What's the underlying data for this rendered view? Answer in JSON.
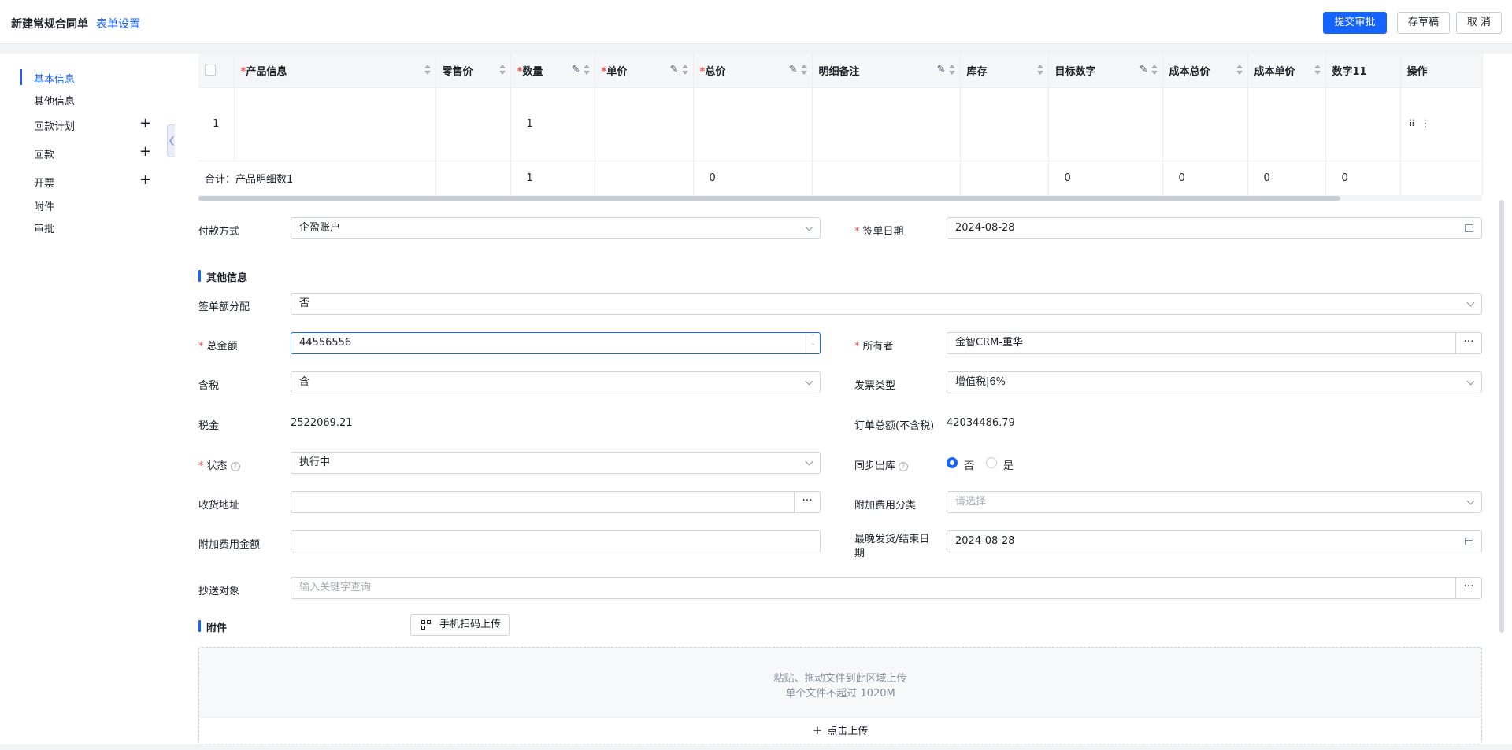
{
  "header": {
    "title": "新建常规合同单",
    "form_settings": "表单设置",
    "submit": "提交审批",
    "draft": "存草稿",
    "cancel": "取 消"
  },
  "sidebar": {
    "items": [
      {
        "label": "基本信息",
        "active": true
      },
      {
        "label": "其他信息"
      },
      {
        "label": "回款计划",
        "has_add": true
      },
      {
        "label": "回款",
        "has_add": true
      },
      {
        "label": "开票",
        "has_add": true
      },
      {
        "label": "附件"
      },
      {
        "label": "审批"
      }
    ],
    "collapse_icon": "collapse-left-icon"
  },
  "table": {
    "columns": [
      {
        "label": "产品信息",
        "required": true
      },
      {
        "label": "零售价"
      },
      {
        "label": "数量",
        "required": true,
        "editable": true
      },
      {
        "label": "单价",
        "required": true,
        "editable": true
      },
      {
        "label": "总价",
        "required": true,
        "editable": true
      },
      {
        "label": "明细备注",
        "editable": true
      },
      {
        "label": "库存"
      },
      {
        "label": "目标数字",
        "editable": true
      },
      {
        "label": "成本总价"
      },
      {
        "label": "成本单价"
      },
      {
        "label": "数字11"
      },
      {
        "label": "操作"
      }
    ],
    "row": {
      "index": "1",
      "qty": "1"
    },
    "summary": {
      "label": "合计：产品明细数1",
      "qty": "1",
      "total": "0",
      "target": "0",
      "cost_total": "0",
      "cost_unit": "0",
      "num11": "0"
    }
  },
  "form": {
    "payment_method": {
      "label": "付款方式",
      "value": "企盈账户"
    },
    "sign_date": {
      "label": "签单日期",
      "value": "2024-08-28"
    },
    "other_info_title": "其他信息",
    "sign_alloc": {
      "label": "签单额分配",
      "value": "否"
    },
    "total_amount": {
      "label": "总金额",
      "value": "44556556"
    },
    "owner": {
      "label": "所有者",
      "value": "金智CRM-重华"
    },
    "tax_included": {
      "label": "含税",
      "value": "含"
    },
    "invoice_type": {
      "label": "发票类型",
      "value": "增值税|6%"
    },
    "tax": {
      "label": "税金",
      "value": "2522069.21"
    },
    "order_total_ex_tax": {
      "label": "订单总额(不含税)",
      "value": "42034486.79"
    },
    "status": {
      "label": "状态",
      "value": "执行中"
    },
    "sync_outbound": {
      "label": "同步出库",
      "options": [
        "否",
        "是"
      ],
      "selected": "否"
    },
    "shipping_address": {
      "label": "收货地址",
      "value": ""
    },
    "extra_fee_category": {
      "label": "附加费用分类",
      "placeholder": "请选择"
    },
    "extra_fee_amount": {
      "label": "附加费用金额",
      "value": ""
    },
    "latest_ship_date": {
      "label_line1": "最晚发货/结束日",
      "label_line2": "期",
      "value": "2024-08-28"
    },
    "cc": {
      "label": "抄送对象",
      "placeholder": "输入关键字查询"
    }
  },
  "attachments": {
    "title": "附件",
    "scan_upload": "手机扫码上传",
    "drop_hint": "粘贴、拖动文件到此区域上传",
    "size_hint": "单个文件不超过 1020M",
    "click_upload": "点击上传"
  },
  "colors": {
    "accent": "#1664ff",
    "required": "#f54a45"
  }
}
